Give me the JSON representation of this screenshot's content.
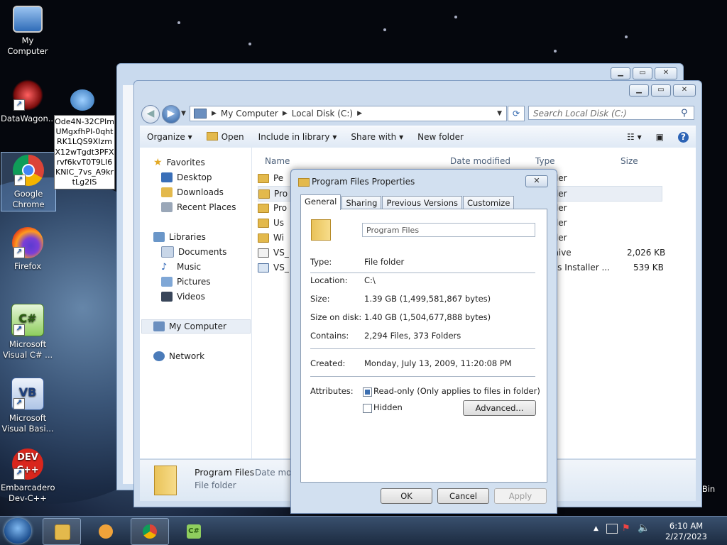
{
  "desktop": {
    "icons": [
      {
        "label": "My Computer"
      },
      {
        "label": "DataWagon..."
      },
      {
        "label": "Google Chrome"
      },
      {
        "label": "Firefox"
      },
      {
        "label": "Microsoft Visual C# ..."
      },
      {
        "label": "Microsoft Visual Basi..."
      },
      {
        "label": "Embarcadero Dev-C++"
      }
    ],
    "tooltip_text": "Ode4N-32CPImUMgxfhPI-0qhtRK1LQS9XIzmX12wTgdt3PFXrvf6kvT0T9LI6KNIC_7vs_A9krtLg2IS",
    "recycle_label": "Bin"
  },
  "explorer": {
    "address": {
      "crumbs": [
        "My Computer",
        "Local Disk (C:)"
      ]
    },
    "search_placeholder": "Search Local Disk (C:)",
    "toolbar": {
      "organize": "Organize",
      "open": "Open",
      "include_in_library": "Include in library",
      "share_with": "Share with",
      "new_folder": "New folder"
    },
    "nav": {
      "favorites": "Favorites",
      "desktop": "Desktop",
      "downloads": "Downloads",
      "recent_places": "Recent Places",
      "libraries": "Libraries",
      "documents": "Documents",
      "music": "Music",
      "pictures": "Pictures",
      "videos": "Videos",
      "my_computer": "My Computer",
      "network": "Network"
    },
    "columns": {
      "name": "Name",
      "date_modified": "Date modified",
      "type": "Type",
      "size": "Size"
    },
    "rows": [
      {
        "name": "Pe",
        "type": "older",
        "size": ""
      },
      {
        "name": "Pro",
        "type": "older",
        "size": ""
      },
      {
        "name": "Pro",
        "type": "older",
        "size": ""
      },
      {
        "name": "Us",
        "type": "older",
        "size": ""
      },
      {
        "name": "Wi",
        "type": "older",
        "size": ""
      },
      {
        "name": "VS_",
        "type": "rchive",
        "size": "2,026 KB"
      },
      {
        "name": "VS_",
        "type": "ows Installer ...",
        "size": "539 KB"
      }
    ],
    "details": {
      "name": "Program Files",
      "type": "File folder",
      "date_label": "Date mod"
    }
  },
  "properties": {
    "title": "Program Files Properties",
    "tabs": [
      "General",
      "Sharing",
      "Previous Versions",
      "Customize"
    ],
    "folder_name": "Program Files",
    "fields": {
      "type_label": "Type:",
      "type_value": "File folder",
      "location_label": "Location:",
      "location_value": "C:\\",
      "size_label": "Size:",
      "size_value": "1.39 GB (1,499,581,867 bytes)",
      "size_on_disk_label": "Size on disk:",
      "size_on_disk_value": "1.40 GB (1,504,677,888 bytes)",
      "contains_label": "Contains:",
      "contains_value": "2,294 Files, 373 Folders",
      "created_label": "Created:",
      "created_value": "Monday, July 13, 2009, 11:20:08 PM",
      "attributes_label": "Attributes:"
    },
    "readonly_label": "Read-only (Only applies to files in folder)",
    "hidden_label": "Hidden",
    "advanced_button": "Advanced...",
    "ok_button": "OK",
    "cancel_button": "Cancel",
    "apply_button": "Apply"
  },
  "taskbar": {
    "time": "6:10 AM",
    "date": "2/27/2023"
  }
}
